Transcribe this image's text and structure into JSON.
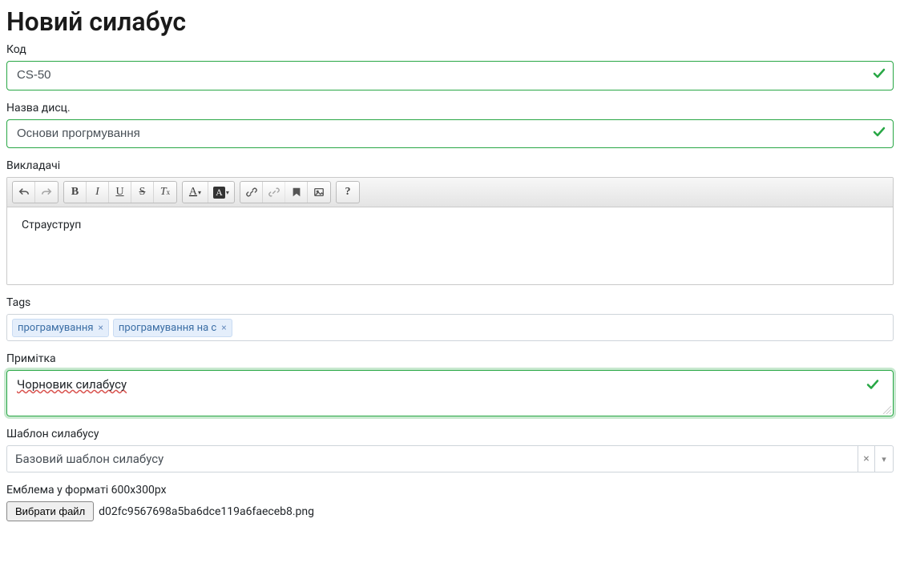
{
  "heading": "Новий силабус",
  "fields": {
    "code": {
      "label": "Код",
      "value": "CS-50"
    },
    "name": {
      "label": "Назва дисц.",
      "value": "Основи прогрмування"
    },
    "teachers": {
      "label": "Викладачі",
      "content": "Страуструп"
    },
    "tags": {
      "label": "Tags",
      "items": [
        {
          "text": "програмування"
        },
        {
          "text": "програмування на c"
        }
      ]
    },
    "note": {
      "label": "Примітка",
      "value": "Чорновик силабусу"
    },
    "template": {
      "label": "Шаблон силабусу",
      "value": "Базовий шаблон силабусу"
    },
    "emblem": {
      "label": "Емблема у форматі 600х300рх",
      "button": "Вибрати файл",
      "filename": "d02fc9567698a5ba6dce119a6faeceb8.png"
    }
  },
  "toolbar": {
    "undo": "undo",
    "redo": "redo",
    "bold": "B",
    "italic": "I",
    "underline": "U",
    "strike": "S",
    "removefmt": "Tx",
    "textcolor": "A",
    "bgcolor": "A",
    "link": "link",
    "unlink": "unlink",
    "anchor": "flag",
    "image": "image",
    "help": "?"
  }
}
